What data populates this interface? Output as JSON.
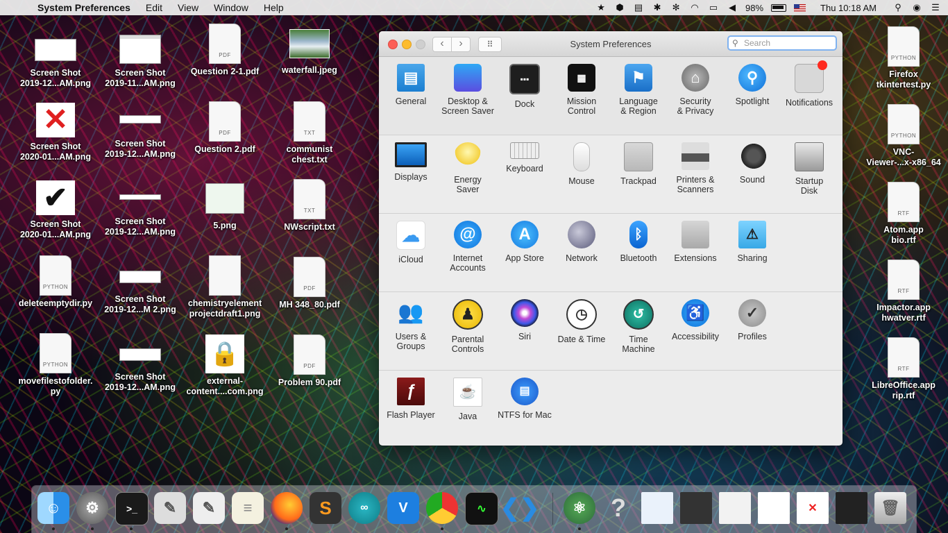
{
  "menubar": {
    "app": "System Preferences",
    "menus": [
      "Edit",
      "View",
      "Window",
      "Help"
    ],
    "battery": "98%",
    "clock": "Thu 10:18 AM"
  },
  "desktop": {
    "col1": [
      {
        "name": "Screen Shot\n2019-12...AM.png",
        "kind": "shot"
      },
      {
        "name": "Screen Shot\n2020-01...AM.png",
        "kind": "redx"
      },
      {
        "name": "Screen Shot\n2020-01...AM.png",
        "kind": "check"
      },
      {
        "name": "deleteemptydir.py",
        "kind": "python"
      },
      {
        "name": "movefilestofolder.\npy",
        "kind": "python"
      }
    ],
    "col2": [
      {
        "name": "Screen Shot\n2019-11...AM.png"
      },
      {
        "name": "Screen Shot\n2019-12...AM.png"
      },
      {
        "name": "Screen Shot\n2019-12...AM.png"
      },
      {
        "name": "Screen Shot\n2019-12...M 2.png"
      },
      {
        "name": "Screen Shot\n2019-12...AM.png"
      }
    ],
    "col3": [
      {
        "name": "Question 2-1.pdf"
      },
      {
        "name": "Question 2.pdf"
      },
      {
        "name": "5.png"
      },
      {
        "name": "chemistryelement\nprojectdraft1.png"
      },
      {
        "name": "external-\ncontent....com.png"
      }
    ],
    "col4": [
      {
        "name": "waterfall.jpeg"
      },
      {
        "name": "communist\nchest.txt"
      },
      {
        "name": "NWscript.txt"
      },
      {
        "name": "MH 348_80.pdf"
      },
      {
        "name": "Problem 90.pdf"
      }
    ],
    "right": [
      {
        "name": "Firefox\ntkintertest.py"
      },
      {
        "name": "VNC-\nViewer-...x-x86_64"
      },
      {
        "name": "Atom.app\nbio.rtf"
      },
      {
        "name": "Impactor.app\nhwatver.rtf"
      },
      {
        "name": "LibreOffice.app\nrip.rtf"
      }
    ],
    "doc_tags": {
      "pdf": "PDF",
      "txt": "TXT",
      "python": "PYTHON",
      "rtf": "RTF"
    }
  },
  "window": {
    "title": "System Preferences",
    "search_placeholder": "Search",
    "rows": [
      [
        {
          "label": "General",
          "icon": "general-icon"
        },
        {
          "label": "Desktop &\nScreen Saver",
          "icon": "desktop-icon"
        },
        {
          "label": "Dock",
          "icon": "dock-icon"
        },
        {
          "label": "Mission\nControl",
          "icon": "mission-control-icon"
        },
        {
          "label": "Language\n& Region",
          "icon": "language-icon"
        },
        {
          "label": "Security\n& Privacy",
          "icon": "security-icon"
        },
        {
          "label": "Spotlight",
          "icon": "spotlight-icon"
        },
        {
          "label": "Notifications",
          "icon": "notifications-icon"
        }
      ],
      [
        {
          "label": "Displays",
          "icon": "displays-icon"
        },
        {
          "label": "Energy\nSaver",
          "icon": "energy-icon"
        },
        {
          "label": "Keyboard",
          "icon": "keyboard-icon"
        },
        {
          "label": "Mouse",
          "icon": "mouse-icon"
        },
        {
          "label": "Trackpad",
          "icon": "trackpad-icon"
        },
        {
          "label": "Printers &\nScanners",
          "icon": "printer-icon"
        },
        {
          "label": "Sound",
          "icon": "sound-icon"
        },
        {
          "label": "Startup\nDisk",
          "icon": "startup-disk-icon"
        }
      ],
      [
        {
          "label": "iCloud",
          "icon": "icloud-icon"
        },
        {
          "label": "Internet\nAccounts",
          "icon": "internet-accounts-icon"
        },
        {
          "label": "App Store",
          "icon": "app-store-icon"
        },
        {
          "label": "Network",
          "icon": "network-icon"
        },
        {
          "label": "Bluetooth",
          "icon": "bluetooth-icon"
        },
        {
          "label": "Extensions",
          "icon": "extensions-icon"
        },
        {
          "label": "Sharing",
          "icon": "sharing-icon"
        }
      ],
      [
        {
          "label": "Users &\nGroups",
          "icon": "users-icon"
        },
        {
          "label": "Parental\nControls",
          "icon": "parental-icon"
        },
        {
          "label": "Siri",
          "icon": "siri-icon"
        },
        {
          "label": "Date & Time",
          "icon": "clock-icon"
        },
        {
          "label": "Time\nMachine",
          "icon": "time-machine-icon"
        },
        {
          "label": "Accessibility",
          "icon": "accessibility-icon"
        },
        {
          "label": "Profiles",
          "icon": "profiles-icon"
        }
      ],
      [
        {
          "label": "Flash Player",
          "icon": "flash-icon"
        },
        {
          "label": "Java",
          "icon": "java-icon"
        },
        {
          "label": "NTFS for Mac",
          "icon": "ntfs-icon"
        }
      ]
    ]
  },
  "dock": {
    "apps": [
      "Finder",
      "System Preferences",
      "Terminal",
      "Script Editor",
      "TextEdit",
      "Notes",
      "Firefox",
      "Sublime Text",
      "Arduino",
      "VNC Viewer",
      "Chrome",
      "Activity Monitor",
      "VS Code",
      "Atom",
      "Help",
      "Recent 1",
      "Recent 2",
      "Recent 3",
      "Recent 4",
      "Recent 5",
      "Recent 6",
      "Trash"
    ]
  }
}
